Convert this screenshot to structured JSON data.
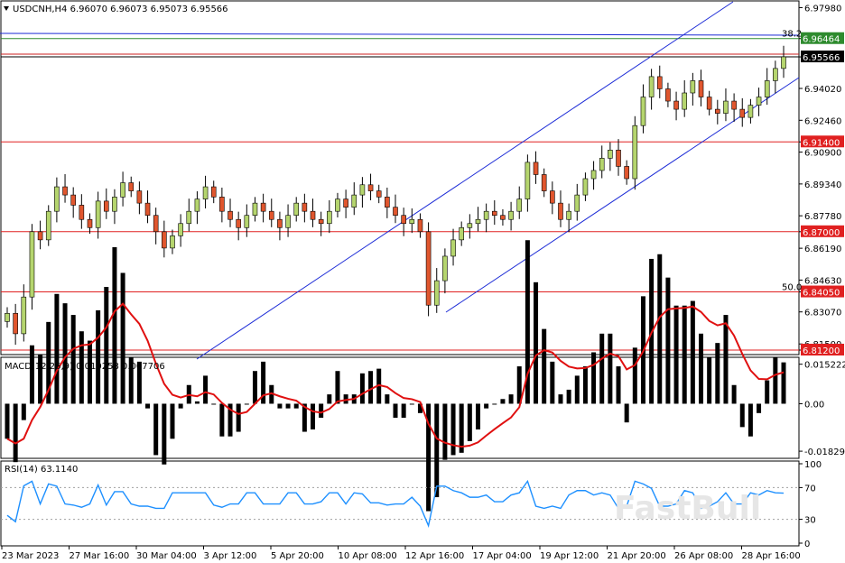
{
  "chart_data": {
    "type": "candlestick",
    "symbol_header": "USDCNH,H4  6.96070 6.96073 6.95073 6.95566",
    "price_axis": {
      "ticks": [
        "6.97980",
        "6.96464",
        "6.95566",
        "6.94020",
        "6.92460",
        "6.91400",
        "6.90900",
        "6.89340",
        "6.87780",
        "6.87000",
        "6.86190",
        "6.84630",
        "6.84050",
        "6.83070",
        "6.81500",
        "6.81200"
      ],
      "range": [
        6.812,
        6.98
      ]
    },
    "horizontal_levels": [
      {
        "price": 6.96464,
        "label": "6.96464",
        "color": "#2e8b2e",
        "kind": "level"
      },
      {
        "price": 6.957,
        "label": "",
        "color": "#cc2222",
        "kind": "line"
      },
      {
        "price": 6.95566,
        "label": "6.95566",
        "color": "#000000",
        "kind": "bid"
      },
      {
        "price": 6.914,
        "label": "6.91400",
        "color": "#e02020",
        "kind": "support"
      },
      {
        "price": 6.87,
        "label": "6.87000",
        "color": "#e02020",
        "kind": "support"
      },
      {
        "price": 6.8405,
        "label": "6.84050",
        "color": "#e02020",
        "kind": "support"
      },
      {
        "price": 6.812,
        "label": "6.81200",
        "color": "#e02020",
        "kind": "support"
      }
    ],
    "fib_labels": [
      {
        "text": "38.2",
        "price": 6.96464
      },
      {
        "text": "50.0",
        "price": 6.8405
      }
    ],
    "x_labels": [
      "23 Mar 2023",
      "27 Mar 16:00",
      "30 Mar 04:00",
      "3 Apr 12:00",
      "5 Apr 20:00",
      "10 Apr 08:00",
      "12 Apr 16:00",
      "17 Apr 04:00",
      "19 Apr 12:00",
      "21 Apr 20:00",
      "26 Apr 08:00",
      "28 Apr 16:00"
    ],
    "candles_close": [
      6.83,
      6.82,
      6.838,
      6.87,
      6.866,
      6.88,
      6.892,
      6.888,
      6.883,
      6.876,
      6.872,
      6.885,
      6.88,
      6.887,
      6.894,
      6.89,
      6.884,
      6.878,
      6.87,
      6.862,
      6.868,
      6.874,
      6.88,
      6.886,
      6.892,
      6.887,
      6.88,
      6.876,
      6.872,
      6.878,
      6.884,
      6.88,
      6.876,
      6.872,
      6.878,
      6.884,
      6.88,
      6.876,
      6.874,
      6.88,
      6.886,
      6.882,
      6.888,
      6.893,
      6.89,
      6.887,
      6.882,
      6.878,
      6.874,
      6.876,
      6.87,
      6.834,
      6.846,
      6.858,
      6.866,
      6.872,
      6.874,
      6.876,
      6.88,
      6.878,
      6.876,
      6.88,
      6.886,
      6.904,
      6.898,
      6.89,
      6.884,
      6.876,
      6.88,
      6.888,
      6.896,
      6.9,
      6.906,
      6.91,
      6.902,
      6.896,
      6.922,
      6.936,
      6.946,
      6.94,
      6.934,
      6.93,
      6.938,
      6.944,
      6.936,
      6.93,
      6.928,
      6.934,
      6.93,
      6.926,
      6.932,
      6.936,
      6.944,
      6.95,
      6.9557
    ],
    "macd": {
      "label": "MACD(12,26,9) 0.010258 0.007706",
      "ticks": [
        "0.015222",
        "0.00",
        "-0.018292"
      ],
      "range": [
        -0.02,
        0.0165
      ]
    },
    "rsi": {
      "label": "RSI(14) 63.1140",
      "ticks": [
        "100",
        "70",
        "30",
        "0"
      ],
      "range": [
        0,
        100
      ],
      "levels": [
        70,
        30
      ]
    },
    "watermark": "FastBull"
  }
}
